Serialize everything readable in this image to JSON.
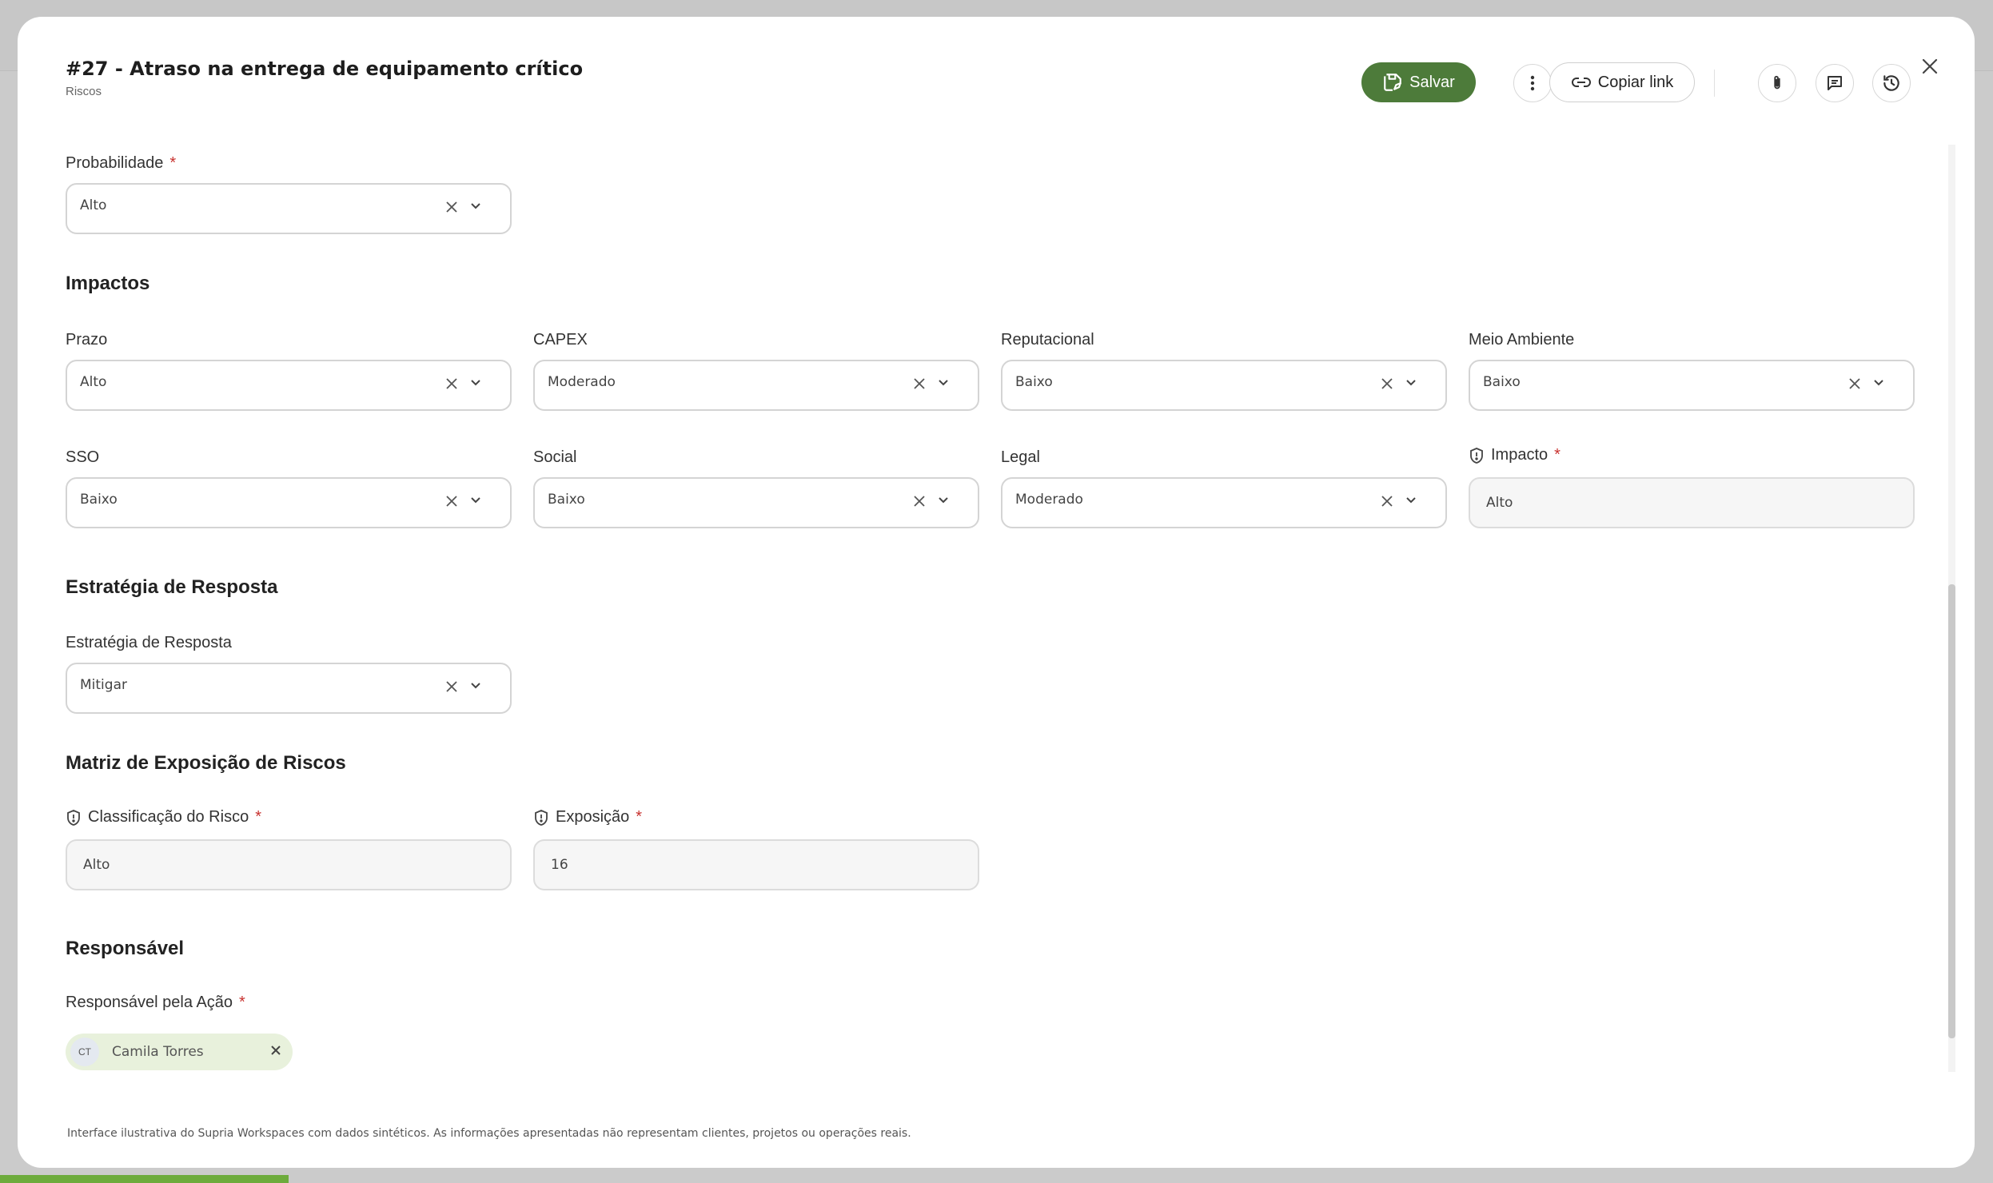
{
  "header": {
    "title": "#27 - Atraso na entrega de equipamento crítico",
    "subtitle": "Riscos"
  },
  "actions": {
    "save_label": "Salvar",
    "copy_link_label": "Copiar link"
  },
  "fields": {
    "probabilidade": {
      "label": "Probabilidade",
      "required": "*",
      "value": "Alto"
    },
    "prazo": {
      "label": "Prazo",
      "value": "Alto"
    },
    "capex": {
      "label": "CAPEX",
      "value": "Moderado"
    },
    "reputacional": {
      "label": "Reputacional",
      "value": "Baixo"
    },
    "meio_ambiente": {
      "label": "Meio Ambiente",
      "value": "Baixo"
    },
    "sso": {
      "label": "SSO",
      "value": "Baixo"
    },
    "social": {
      "label": "Social",
      "value": "Baixo"
    },
    "legal": {
      "label": "Legal",
      "value": "Moderado"
    },
    "impacto": {
      "label": "Impacto",
      "required": "*",
      "value": "Alto"
    },
    "estrategia": {
      "label": "Estratégia de Resposta",
      "value": "Mitigar"
    },
    "classificacao": {
      "label": "Classificação do Risco",
      "required": "*",
      "value": "Alto"
    },
    "exposicao": {
      "label": "Exposição",
      "required": "*",
      "value": "16"
    },
    "responsavel": {
      "label": "Responsável pela Ação",
      "required": "*",
      "chip_initials": "CT",
      "chip_name": "Camila Torres"
    }
  },
  "sections": {
    "impactos": "Impactos",
    "estrategia": "Estratégia de Resposta",
    "matriz": "Matriz de Exposição de Riscos",
    "responsavel": "Responsável"
  },
  "footer_note": "Interface ilustrativa do Supria Workspaces com dados sintéticos. As informações apresentadas não representam clientes, projetos ou operações reais.",
  "colors": {
    "primary": "#4d7b3a",
    "required": "#c8322f",
    "chip_bg": "#e8f1dc",
    "progress": "#6dab3c"
  }
}
